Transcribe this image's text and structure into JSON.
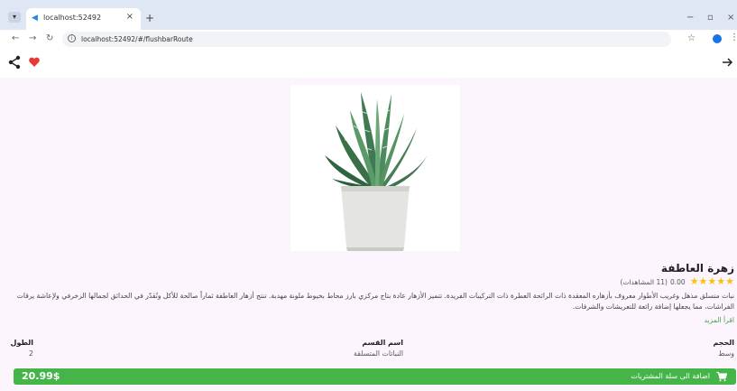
{
  "browser": {
    "tab_title": "localhost:52492",
    "url": "localhost:52492/#/flushbarRoute",
    "tab_close": "×",
    "new_tab": "+",
    "minimize": "−",
    "restore": "▫",
    "close": "×"
  },
  "product": {
    "title": "زهرة العاطفة",
    "rating": "0.00",
    "views": "(11 المشاهدات)",
    "stars": "★★★★★",
    "description": "نبات متسلق مذهل وغريب الأطوار معروف بأزهاره المعقدة ذات الرائحة العطرة ذات التركيبات الفريدة. تتميز الأزهار عادة بتاج مركزي بارز محاط بخيوط ملونة مهدبة. تنتج أزهار العاطفة ثماراً صالحة للأكل وتُقدّر في الحدائق لجمالها الزخرفي ولإعاشة يرقات الفراشات، مما يجعلها إضافة رائعة للتعريشات والشرفات.",
    "read_more": "اقرأ المزيد",
    "specs": {
      "size_label": "الحجم",
      "size_value": "وسط",
      "category_label": "اسم القسم",
      "category_value": "النباتات المتسلقة",
      "height_label": "الطول",
      "height_value": "2"
    },
    "price": "20.99$",
    "add_to_cart": "اضافة الى سلة المشتريات"
  },
  "colors": {
    "accent": "#45b549",
    "star": "#f7c20a",
    "heart": "#e53935",
    "background": "#fcf5fd"
  }
}
